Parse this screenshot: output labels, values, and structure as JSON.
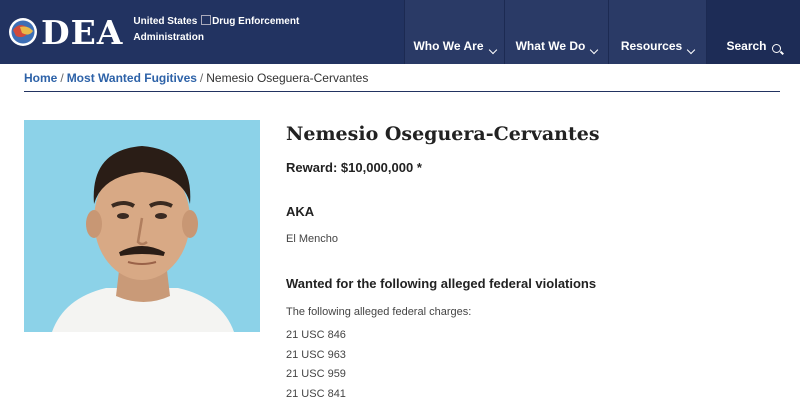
{
  "header": {
    "logo_text": "DEA",
    "agency_line1_a": "United States",
    "agency_line1_b": "Drug Enforcement",
    "agency_line2": "Administration",
    "nav": [
      {
        "label": "Who We Are"
      },
      {
        "label": "What We Do"
      },
      {
        "label": "Resources"
      },
      {
        "label": "Search"
      }
    ]
  },
  "breadcrumb": {
    "home": "Home",
    "section": "Most Wanted Fugitives",
    "current": "Nemesio Oseguera-Cervantes",
    "separator": "/"
  },
  "profile": {
    "name": "Nemesio Oseguera-Cervantes",
    "reward_label": "Reward:",
    "reward_value": "$10,000,000 *",
    "aka_heading": "AKA",
    "aka_value": "El Mencho",
    "violations_heading": "Wanted for the following alleged federal violations",
    "charges_intro": "The following alleged federal charges:",
    "charges": [
      "21 USC 846",
      "21 USC 963",
      "21 USC 959",
      "21 USC 841"
    ]
  },
  "colors": {
    "header_bg": "#223361",
    "link": "#2d62a8",
    "photo_bg": "#8cd2e8"
  },
  "icons": [
    "dea-seal-icon",
    "chevron-down-icon",
    "search-icon"
  ]
}
